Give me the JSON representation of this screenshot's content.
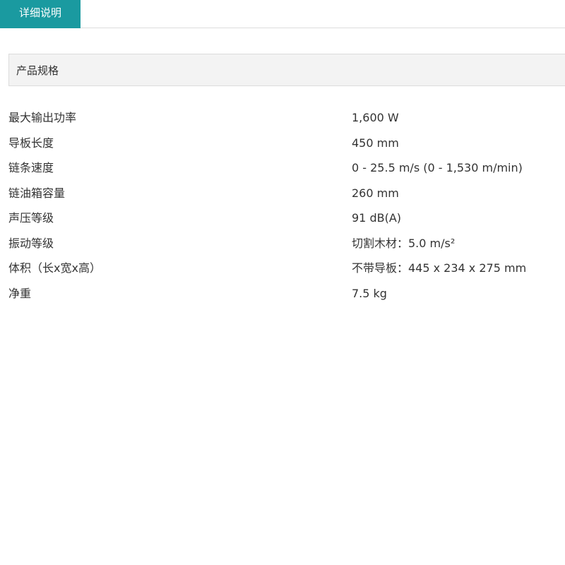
{
  "colors": {
    "accent": "#1a9aa0",
    "header_bg": "#f3f3f3",
    "divider": "#dddddd",
    "text": "#333333"
  },
  "tabs": [
    {
      "label": "详细说明",
      "active": true
    }
  ],
  "section": {
    "title": "产品规格"
  },
  "specs": [
    {
      "label": "最大输出功率",
      "value": "1,600 W"
    },
    {
      "label": "导板长度",
      "value": "450 mm"
    },
    {
      "label": "链条速度",
      "value": "0 - 25.5 m/s (0 - 1,530 m/min)"
    },
    {
      "label": "链油箱容量",
      "value": "260 mm"
    },
    {
      "label": "声压等级",
      "value": "91 dB(A)"
    },
    {
      "label": "振动等级",
      "value": "切割木材：5.0 m/s²"
    },
    {
      "label": "体积（长x宽x高）",
      "value": "不带导板：445 x 234 x 275 mm"
    },
    {
      "label": "净重",
      "value": "7.5 kg"
    }
  ]
}
